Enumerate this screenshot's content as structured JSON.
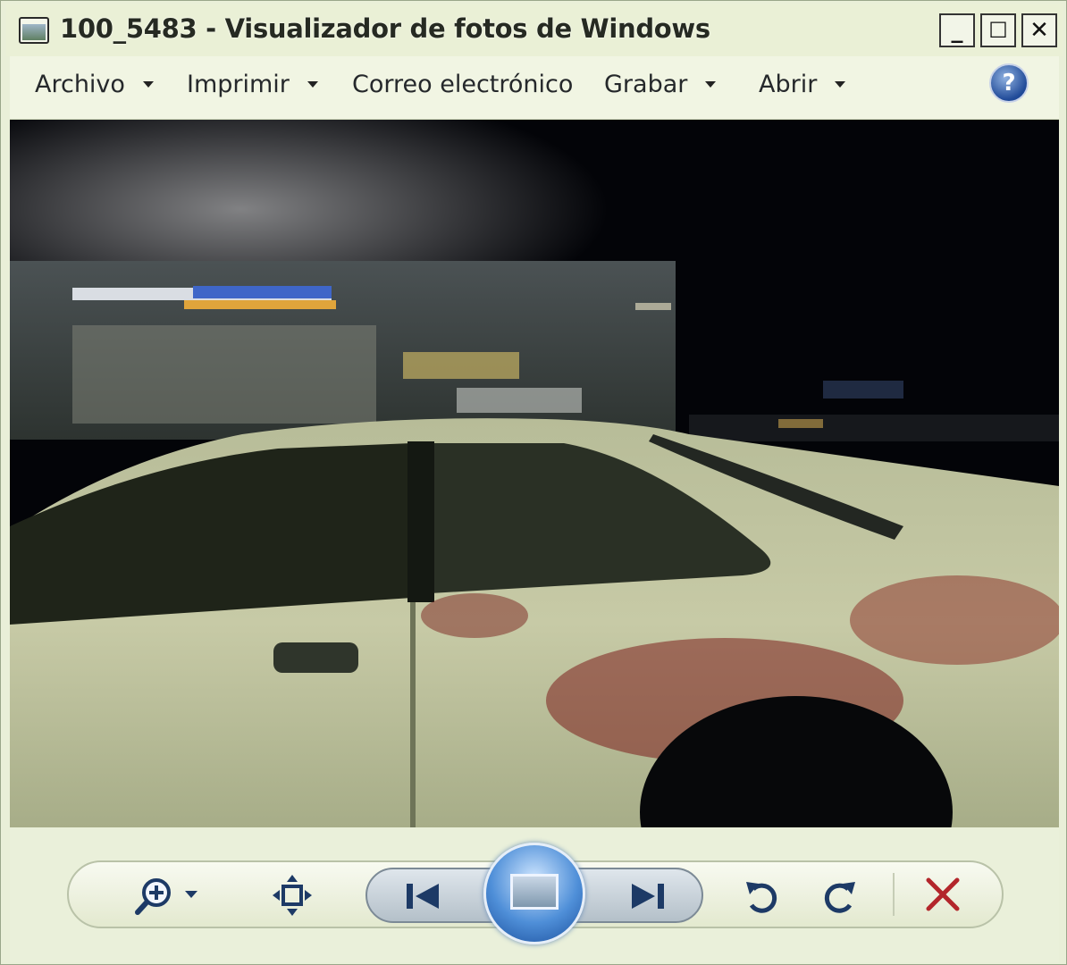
{
  "window": {
    "title": "100_5483 - Visualizador de fotos de Windows",
    "controls": {
      "minimize": "_",
      "maximize": "☐",
      "close": "✕"
    }
  },
  "menu": {
    "items": [
      {
        "label": "Archivo",
        "has_dropdown": true
      },
      {
        "label": "Imprimir",
        "has_dropdown": true
      },
      {
        "label": "Correo electrónico",
        "has_dropdown": false
      },
      {
        "label": "Grabar",
        "has_dropdown": true
      },
      {
        "label": "Abrir",
        "has_dropdown": true
      }
    ],
    "help_icon": "?"
  },
  "photo": {
    "description_icon": "photo-content"
  },
  "controls": {
    "zoom_icon": "zoom-icon",
    "actual_size_icon": "fit-window-icon",
    "previous_icon": "previous-icon",
    "slideshow_icon": "slideshow-icon",
    "next_icon": "next-icon",
    "rotate_left_icon": "rotate-counterclockwise-icon",
    "rotate_right_icon": "rotate-clockwise-icon",
    "delete_icon": "delete-icon"
  },
  "colors": {
    "chrome": "#eaf0da",
    "accent_blue": "#1b4f9d",
    "delete_red": "#b3262b"
  }
}
